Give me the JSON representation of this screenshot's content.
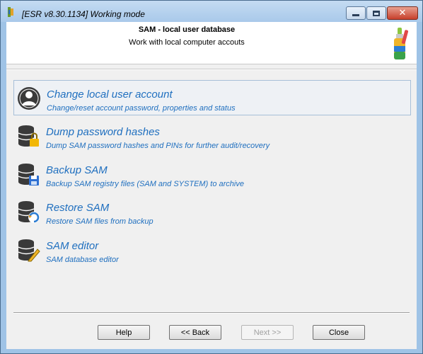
{
  "window": {
    "title": "[ESR v8.30.1134]  Working mode",
    "minimize_label": "Minimize",
    "maximize_label": "Maximize",
    "close_label": "✕"
  },
  "header": {
    "title": "SAM - local user database",
    "subtitle": "Work with local computer accouts",
    "icon": "tools-brush-icon"
  },
  "items": [
    {
      "title": "Change local user account",
      "description": "Change/reset account password, properties and status",
      "icon": "user-avatar-icon",
      "selected": true
    },
    {
      "title": "Dump password hashes",
      "description": "Dump SAM password hashes and PINs for further audit/recovery",
      "icon": "database-lock-icon",
      "selected": false
    },
    {
      "title": "Backup SAM",
      "description": "Backup SAM registry files (SAM and SYSTEM) to archive",
      "icon": "database-save-icon",
      "selected": false
    },
    {
      "title": "Restore SAM",
      "description": "Restore SAM files from backup",
      "icon": "database-restore-icon",
      "selected": false
    },
    {
      "title": "SAM editor",
      "description": "SAM database editor",
      "icon": "database-edit-icon",
      "selected": false
    }
  ],
  "buttons": {
    "help": "Help",
    "back": "<< Back",
    "next": "Next >>",
    "close": "Close"
  },
  "colors": {
    "link": "#1f6fbf",
    "frame": "#9fc3e6"
  }
}
